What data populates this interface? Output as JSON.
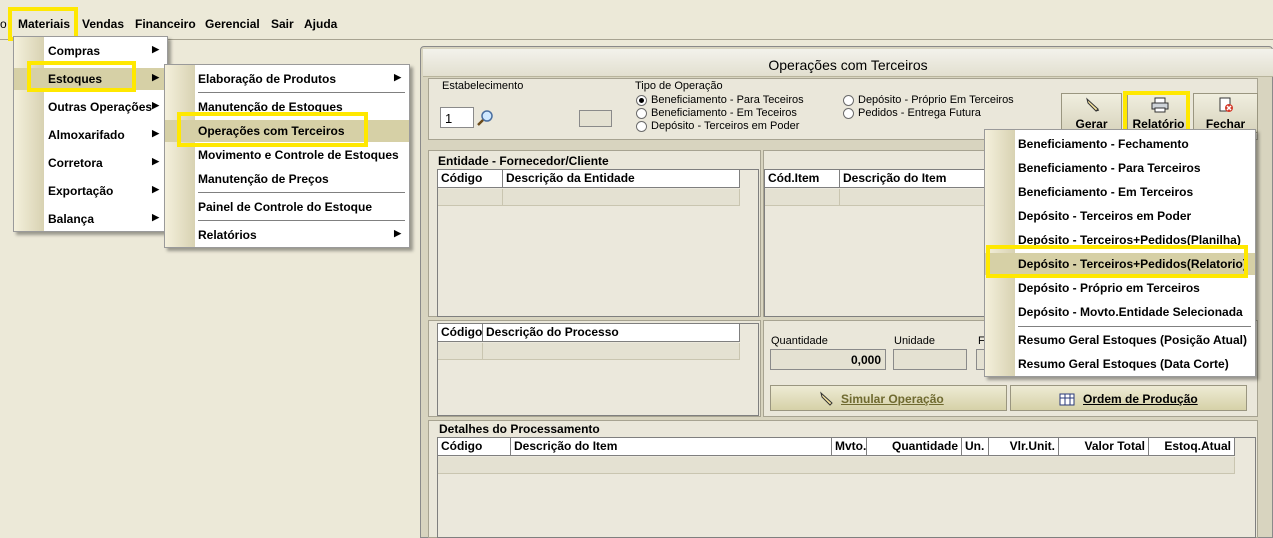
{
  "menubar": {
    "items": [
      "Materiais",
      "Vendas",
      "Financeiro",
      "Gerencial",
      "Sair",
      "Ajuda"
    ],
    "left_cut": "o"
  },
  "menu_materiais": {
    "items": [
      "Compras",
      "Estoques",
      "Outras Operações",
      "Almoxarifado",
      "Corretora",
      "Exportação",
      "Balança"
    ]
  },
  "menu_estoques": {
    "items": [
      "Elaboração de Produtos",
      "Manutenção de Estoques",
      "Operações com Terceiros",
      "Movimento e Controle de Estoques",
      "Manutenção de Preços",
      "Painel de Controle do Estoque",
      "Relatórios"
    ]
  },
  "window": {
    "title": "Operações com Terceiros",
    "estabelecimento_label": "Estabelecimento",
    "estabelecimento_value": "1",
    "tipo_operacao_label": "Tipo de Operação",
    "radios": [
      {
        "label": "Beneficiamento - Para Teceiros",
        "checked": true
      },
      {
        "label": "Beneficiamento - Em Teceiros",
        "checked": false
      },
      {
        "label": "Depósito - Terceiros em Poder",
        "checked": false
      },
      {
        "label": "Depósito - Próprio Em Terceiros",
        "checked": false
      },
      {
        "label": "Pedidos - Entrega Futura",
        "checked": false
      }
    ],
    "toolbar": {
      "gerar": "Gerar",
      "relatorio": "Relatório",
      "fechar": "Fechar"
    },
    "entidade_title": "Entidade - Fornecedor/Cliente",
    "entidade_cols": [
      "Código",
      "Descrição da Entidade"
    ],
    "item_cols": [
      "Cód.Item",
      "Descrição do Item"
    ],
    "processo_cols": [
      "Código",
      "Descrição do Processo"
    ],
    "quantidade_label": "Quantidade",
    "quantidade_value": "0,000",
    "unidade_label": "Unidade",
    "third_label_cut": "F",
    "simular_label": "Simular Operação",
    "ordem_label": "Ordem de Produção",
    "detalhes_title": "Detalhes do Processamento",
    "detalhes_cols": [
      "Código",
      "Descrição do Item",
      "Mvto.",
      "Quantidade",
      "Un.",
      "Vlr.Unit.",
      "Valor Total",
      "Estoq.Atual"
    ]
  },
  "menu_relatorio": {
    "items": [
      "Beneficiamento - Fechamento",
      "Beneficiamento - Para Terceiros",
      "Beneficiamento - Em Terceiros",
      "Depósito - Terceiros em Poder",
      "Depósito - Terceiros+Pedidos(Planilha)",
      "Depósito - Terceiros+Pedidos(Relatorio)",
      "Depósito - Próprio em Terceiros",
      "Depósito - Movto.Entidade Selecionada",
      "Resumo Geral Estoques (Posição Atual)",
      "Resumo Geral Estoques (Data Corte)"
    ]
  },
  "colors": {
    "highlight": "#ffe800",
    "menu_selected": "#d6d0a6",
    "window_bg": "#d8d4bf"
  },
  "icons": [
    "search-icon",
    "gerar-icon",
    "printer-icon",
    "close-icon",
    "simular-icon",
    "ordem-icon",
    "submenu-arrow-icon"
  ]
}
